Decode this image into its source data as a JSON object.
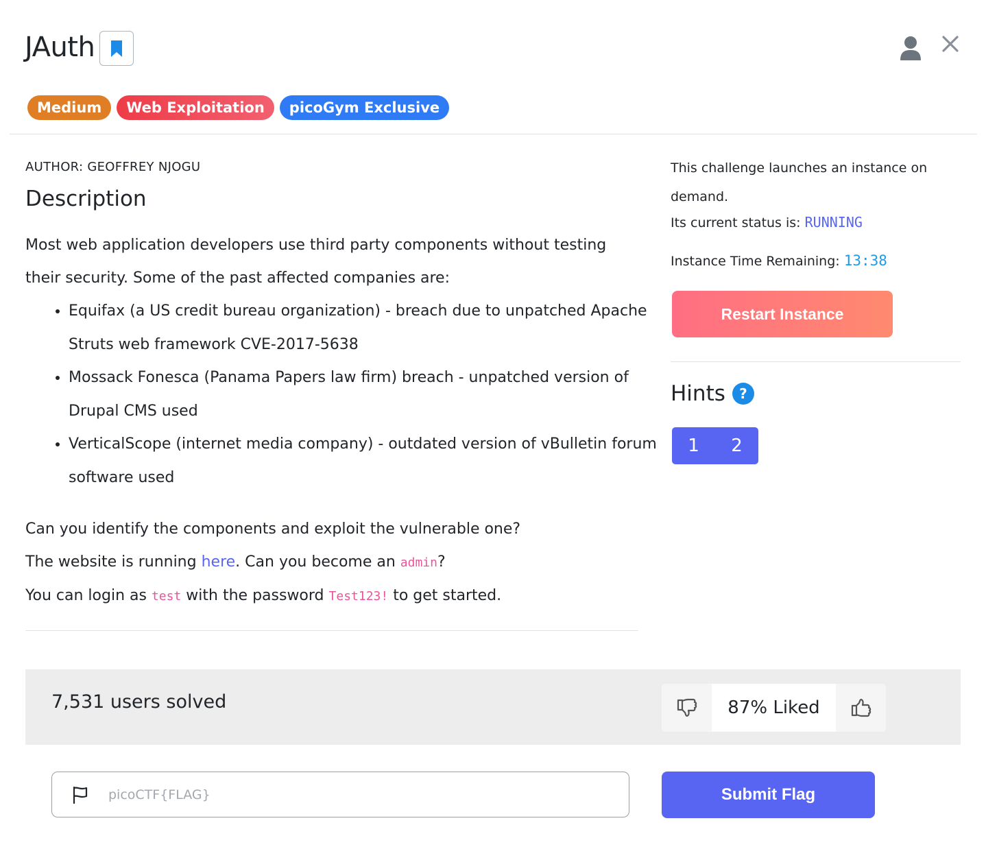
{
  "header": {
    "title": "JAuth",
    "badges": [
      {
        "label": "Medium",
        "color": "#e07e26"
      },
      {
        "label": "Web Exploitation",
        "color": "#ee3c48"
      },
      {
        "label": "picoGym Exclusive",
        "color": "#2f7bf5"
      }
    ]
  },
  "main": {
    "author": "AUTHOR: GEOFFREY NJOGU",
    "description_heading": "Description",
    "intro": "Most web application developers use third party components without testing their security. Some of the past affected companies are:",
    "list": [
      "Equifax (a US credit bureau organization) - breach due to unpatched Apache Struts web framework CVE-2017-5638",
      "Mossack Fonesca (Panama Papers law firm) breach - unpatched version of Drupal CMS used",
      "VerticalScope (internet media company) - outdated version of vBulletin forum software used"
    ],
    "question": "Can you identify the components and exploit the vulnerable one?",
    "running_prefix": "The website is running ",
    "running_link": "here",
    "running_mid": ". Can you become an ",
    "running_code": "admin",
    "running_suffix": "?",
    "login_prefix": "You can login as ",
    "login_user": "test",
    "login_mid": " with the password ",
    "login_pass": "Test123!",
    "login_suffix": " to get started."
  },
  "instance": {
    "launch_text": "This challenge launches an instance on demand.",
    "status_label": "Its current status is: ",
    "status_value": "RUNNING",
    "time_label": "Instance Time Remaining: ",
    "time_value": "13:38",
    "restart_label": "Restart Instance"
  },
  "hints": {
    "heading": "Hints",
    "help_glyph": "?",
    "items": [
      "1",
      "2"
    ]
  },
  "stats": {
    "solved": "7,531 users solved",
    "liked": "87% Liked"
  },
  "flag_form": {
    "placeholder": "picoCTF{FLAG}",
    "submit_label": "Submit Flag"
  }
}
